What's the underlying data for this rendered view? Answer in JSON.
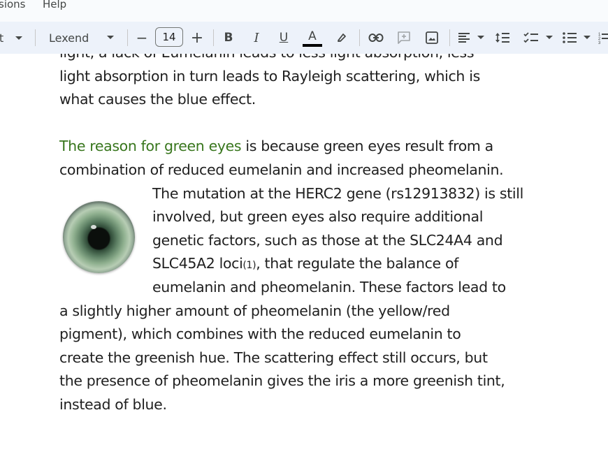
{
  "menu": {
    "item_extensions_partial": "sions",
    "item_help": "Help"
  },
  "toolbar": {
    "font_name": "Lexend",
    "font_size": "14",
    "minus": "−",
    "plus": "+",
    "bold": "B",
    "italic": "I",
    "underline": "U",
    "text_color": "A",
    "text_color_value": "#000000"
  },
  "document": {
    "lines_top": [
      "light, a lack of Eumelanin leads to less light absorption, less",
      "light absorption in turn leads to Rayleigh scattering, which is",
      "what causes the blue effect."
    ],
    "green_heading": "The reason for green eyes",
    "line_heading_rest": " is because green eyes result from a",
    "line_2": "combination of reduced eumelanin and increased pheomelanin.",
    "wrap_lines": [
      "The mutation at the HERC2 gene (rs12913832) is still",
      "involved, but green eyes also require additional",
      "genetic factors, such as those at the SLC24A4 and"
    ],
    "loci_before": "SLC45A2 loci",
    "loci_ref": "(1)",
    "loci_after": ", that regulate the balance of",
    "wrap_last": "eumelanin and pheomelanin. These factors lead to",
    "lines_bottom": [
      "a slightly higher amount of pheomelanin (the yellow/red",
      "pigment), which combines with the reduced eumelanin to",
      "create the greenish hue. The scattering effect still occurs, but",
      "the presence of pheomelanin gives the iris a more greenish tint,",
      "instead of blue."
    ],
    "accent_green": "#38761d"
  }
}
